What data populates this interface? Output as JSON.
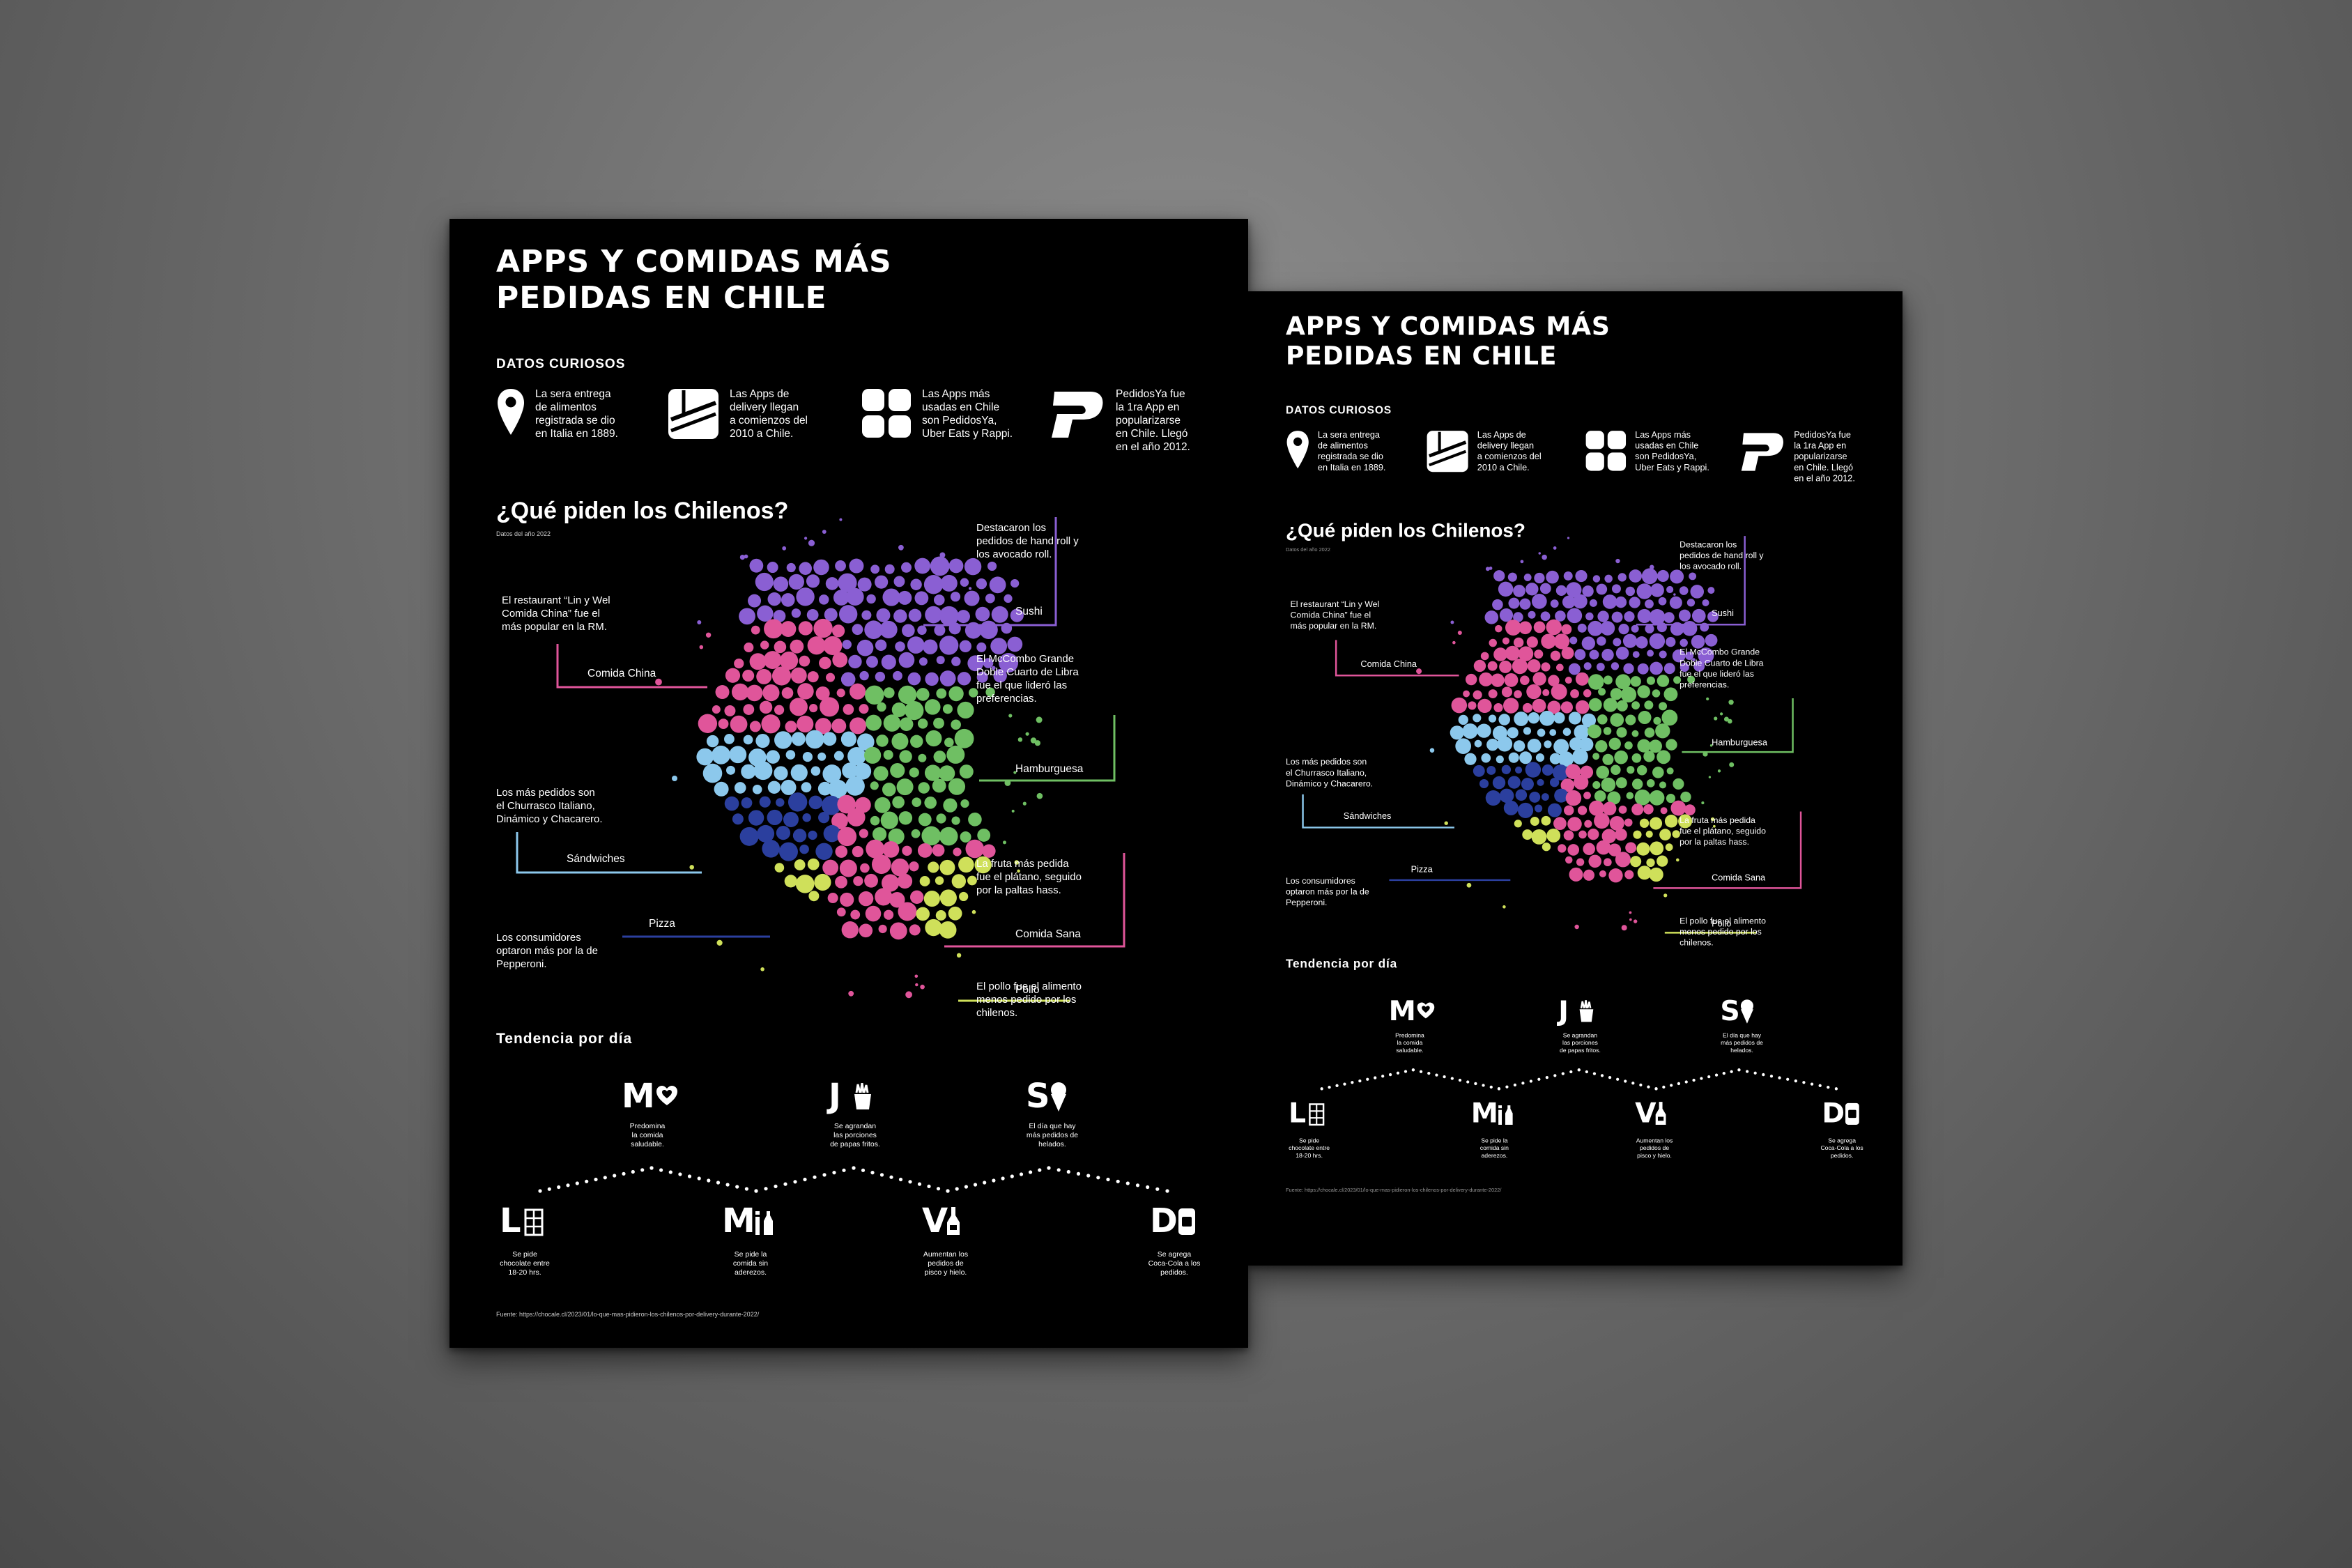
{
  "poster": {
    "title": "APPS Y COMIDAS MÁS PEDIDAS EN CHILE",
    "facts_heading": "DATOS CURIOSOS",
    "facts": [
      {
        "icon": "location-pin-icon",
        "text": "La sera entrega\nde alimentos\nregistrada se dio\nen Italia en 1889."
      },
      {
        "icon": "delivery-box-icon",
        "text": "Las Apps de\ndelivery llegan\na comienzos del\n2010 a Chile."
      },
      {
        "icon": "apps-grid-icon",
        "text": "Las Apps más\nusadas en Chile\nson PedidosYa,\nUber Eats y Rappi."
      },
      {
        "icon": "pedidosya-logo-icon",
        "text": "PedidosYa fue\nla 1ra App en\npopularizarse\nen Chile. Llegó\nen el año 2012."
      }
    ],
    "question": "¿Qué piden los Chilenos?",
    "year_note": "Datos del año 2022",
    "chart_data": {
      "type": "bubble-cluster",
      "categories": [
        {
          "label": "Sushi",
          "color": "#8a5fd3",
          "note": "Destacaron los\npedidos de hand roll y\nlos avocado roll."
        },
        {
          "label": "Comida China",
          "color": "#e0559a",
          "note": "El restaurant “Lin y Wel\nComida China” fue el\nmás popular en la RM."
        },
        {
          "label": "Hamburguesa",
          "color": "#6fbf63",
          "note": "El McCombo Grande\nDoble Cuarto de Libra\nfue el que lideró las\npreferencias."
        },
        {
          "label": "Sándwiches",
          "color": "#8cc8ec",
          "note": "Los más pedidos son\nel Churrasco Italiano,\nDinámico y Chacarero."
        },
        {
          "label": "Comida Sana",
          "color": "#e0559a",
          "note": "La fruta más pedida\nfue el plátano, seguido\npor la paltas hass."
        },
        {
          "label": "Pizza",
          "color": "#2b3f9e",
          "note": "Los consumidores\noptaron más por la de\nPepperoni."
        },
        {
          "label": "Pollo",
          "color": "#cfe05a",
          "note": "El pollo fue el alimento\nmenos pedido por los\nchilenos."
        }
      ]
    },
    "trend_heading": "Tendencia por día",
    "days": [
      {
        "letter": "L",
        "icon": "chocolate-icon",
        "note": "Se pide\nchocolate entre\n18-20 hrs."
      },
      {
        "letter": "M",
        "icon": "heart-icon",
        "note": "Predomina\nla comida\nsaludable."
      },
      {
        "letter": "M",
        "icon": "drink-icon",
        "note": "Se pide la\ncomida sin\naderezos."
      },
      {
        "letter": "J",
        "icon": "fries-icon",
        "note": "Se agrandan\nlas porciones\nde papas fritos."
      },
      {
        "letter": "V",
        "icon": "bottle-icon",
        "note": "Aumentan los\npedidos de\npisco y hielo."
      },
      {
        "letter": "S",
        "icon": "ice-cream-icon",
        "note": "El día que hay\nmás pedidos de\nhelados."
      },
      {
        "letter": "D",
        "icon": "soda-can-icon",
        "note": "Se agrega\nCoca-Cola a los\npedidos."
      }
    ],
    "source": "Fuente: https://chocale.cl/2023/01/lo-que-mas-pidieron-los-chilenos-por-delivery-durante-2022/"
  }
}
